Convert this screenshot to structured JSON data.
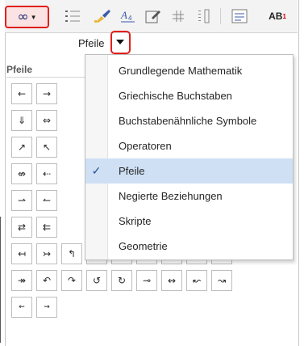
{
  "toolbar": {
    "infinity_glyph": "∞",
    "ab_label": "AB",
    "ab_superscript": "1"
  },
  "category": {
    "current": "Pfeile"
  },
  "section": {
    "title": "Pfeile"
  },
  "symbols": [
    "←",
    "→",
    "⇓",
    "⇔",
    "↗",
    "↖",
    "⇎",
    "⇠",
    "⇀",
    "↼",
    "⇄",
    "⇇",
    "↤",
    "↣",
    "↰",
    "↱",
    "↲",
    "↳",
    "⇚",
    "⇛",
    "↞",
    "↠",
    "↶",
    "↷",
    "↺",
    "↻",
    "⊸",
    "↭",
    "↜",
    "↝",
    "⇜",
    "⇝"
  ],
  "menu": {
    "items": [
      {
        "label": "Grundlegende Mathematik",
        "checked": false
      },
      {
        "label": "Griechische Buchstaben",
        "checked": false
      },
      {
        "label": "Buchstabenähnliche Symbole",
        "checked": false
      },
      {
        "label": "Operatoren",
        "checked": false
      },
      {
        "label": "Pfeile",
        "checked": true
      },
      {
        "label": "Negierte Beziehungen",
        "checked": false
      },
      {
        "label": "Skripte",
        "checked": false
      },
      {
        "label": "Geometrie",
        "checked": false
      }
    ],
    "check_glyph": "✓"
  },
  "colors": {
    "highlight_border": "#e0201c",
    "selected_item": "#cfe0f5"
  }
}
